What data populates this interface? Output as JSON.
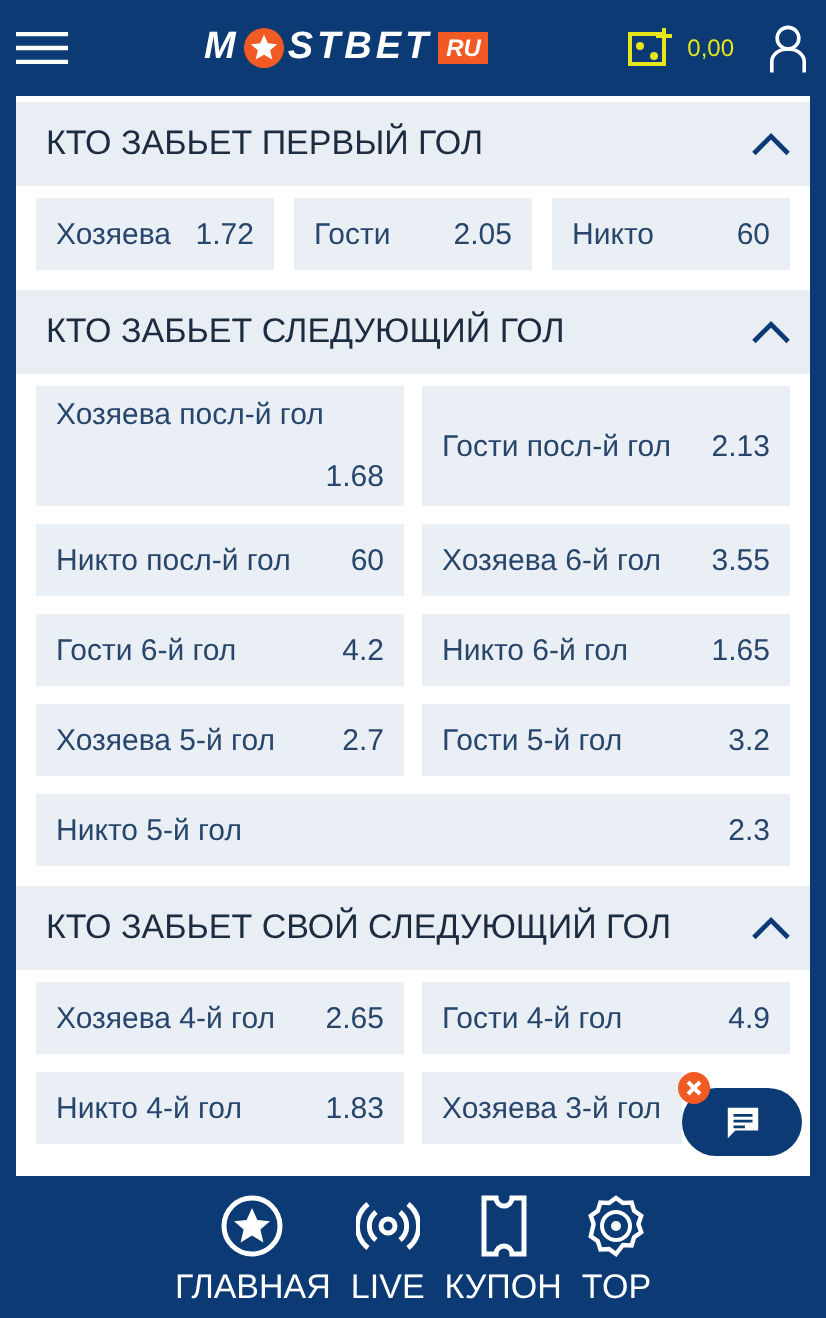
{
  "header": {
    "logo": {
      "before": "M",
      "after": "STBET",
      "badge": "RU"
    },
    "balance": "0,00"
  },
  "sections": [
    {
      "title": "КТО ЗАБЬЕТ ПЕРВЫЙ ГОЛ",
      "expanded": true,
      "kind": "triple",
      "bets": [
        {
          "name": "Хозяева",
          "odd": "1.72"
        },
        {
          "name": "Гости",
          "odd": "2.05"
        },
        {
          "name": "Никто",
          "odd": "60"
        }
      ]
    },
    {
      "title": "КТО ЗАБЬЕТ СЛЕДУЮЩИЙ ГОЛ",
      "expanded": true,
      "kind": "double",
      "bets": [
        {
          "name": "Хозяева посл-й гол",
          "odd": "1.68"
        },
        {
          "name": "Гости посл-й гол",
          "odd": "2.13"
        },
        {
          "name": "Никто посл-й гол",
          "odd": "60"
        },
        {
          "name": "Хозяева 6-й гол",
          "odd": "3.55"
        },
        {
          "name": "Гости 6-й гол",
          "odd": "4.2"
        },
        {
          "name": "Никто 6-й гол",
          "odd": "1.65"
        },
        {
          "name": "Хозяева 5-й гол",
          "odd": "2.7"
        },
        {
          "name": "Гости 5-й гол",
          "odd": "3.2"
        },
        {
          "name": "Никто 5-й гол",
          "odd": "2.3"
        }
      ]
    },
    {
      "title": "КТО ЗАБЬЕТ СВОЙ СЛЕДУЮЩИЙ ГОЛ",
      "expanded": true,
      "kind": "double",
      "bets": [
        {
          "name": "Хозяева 4-й гол",
          "odd": "2.65"
        },
        {
          "name": "Гости 4-й гол",
          "odd": "4.9"
        },
        {
          "name": "Никто 4-й гол",
          "odd": "1.83"
        },
        {
          "name": "Хозяева 3-й гол"
        }
      ]
    }
  ],
  "nav": [
    {
      "kind": "home",
      "label": "ГЛАВНАЯ"
    },
    {
      "kind": "live",
      "label": "LIVE"
    },
    {
      "kind": "coupon",
      "label": "КУПОН"
    },
    {
      "kind": "top",
      "label": "TOP"
    }
  ]
}
